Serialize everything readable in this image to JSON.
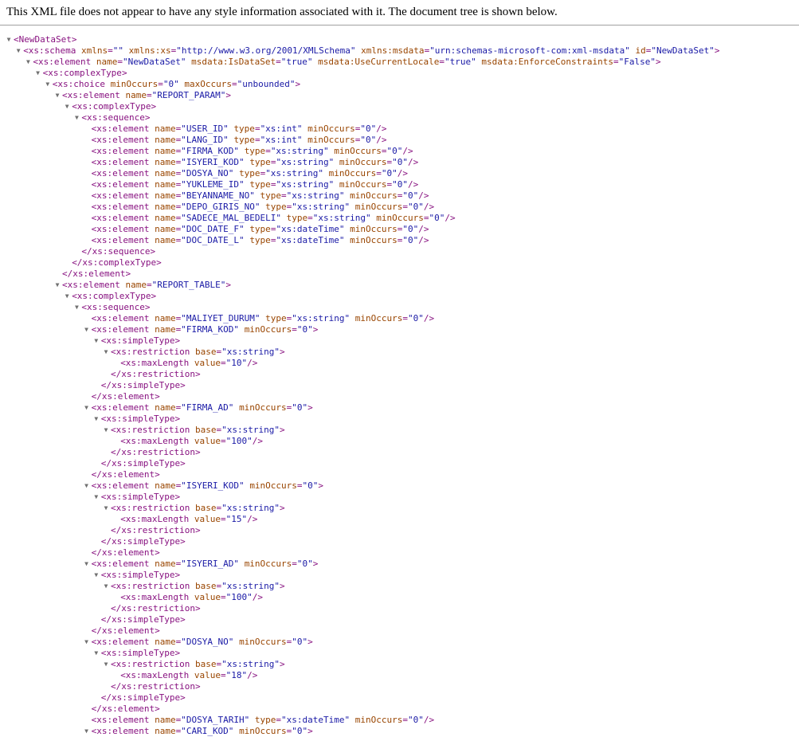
{
  "header_text": "This XML file does not appear to have any style information associated with it. The document tree is shown below.",
  "colors": {
    "tag": "#881280",
    "attribute_name": "#994500",
    "attribute_value": "#1a1aa6",
    "toggle": "#707070"
  },
  "toggle_glyph": "▼",
  "lines": [
    {
      "depth": 0,
      "toggle": true,
      "kind": "open",
      "tag": "NewDataSet",
      "attrs": []
    },
    {
      "depth": 1,
      "toggle": true,
      "kind": "open",
      "tag": "xs:schema",
      "attrs": [
        [
          "xmlns",
          ""
        ],
        [
          "xmlns:xs",
          "http://www.w3.org/2001/XMLSchema"
        ],
        [
          "xmlns:msdata",
          "urn:schemas-microsoft-com:xml-msdata"
        ],
        [
          "id",
          "NewDataSet"
        ]
      ]
    },
    {
      "depth": 2,
      "toggle": true,
      "kind": "open",
      "tag": "xs:element",
      "attrs": [
        [
          "name",
          "NewDataSet"
        ],
        [
          "msdata:IsDataSet",
          "true"
        ],
        [
          "msdata:UseCurrentLocale",
          "true"
        ],
        [
          "msdata:EnforceConstraints",
          "False"
        ]
      ]
    },
    {
      "depth": 3,
      "toggle": true,
      "kind": "open",
      "tag": "xs:complexType",
      "attrs": []
    },
    {
      "depth": 4,
      "toggle": true,
      "kind": "open",
      "tag": "xs:choice",
      "attrs": [
        [
          "minOccurs",
          "0"
        ],
        [
          "maxOccurs",
          "unbounded"
        ]
      ]
    },
    {
      "depth": 5,
      "toggle": true,
      "kind": "open",
      "tag": "xs:element",
      "attrs": [
        [
          "name",
          "REPORT_PARAM"
        ]
      ]
    },
    {
      "depth": 6,
      "toggle": true,
      "kind": "open",
      "tag": "xs:complexType",
      "attrs": []
    },
    {
      "depth": 7,
      "toggle": true,
      "kind": "open",
      "tag": "xs:sequence",
      "attrs": []
    },
    {
      "depth": 8,
      "toggle": false,
      "kind": "self",
      "tag": "xs:element",
      "attrs": [
        [
          "name",
          "USER_ID"
        ],
        [
          "type",
          "xs:int"
        ],
        [
          "minOccurs",
          "0"
        ]
      ]
    },
    {
      "depth": 8,
      "toggle": false,
      "kind": "self",
      "tag": "xs:element",
      "attrs": [
        [
          "name",
          "LANG_ID"
        ],
        [
          "type",
          "xs:int"
        ],
        [
          "minOccurs",
          "0"
        ]
      ]
    },
    {
      "depth": 8,
      "toggle": false,
      "kind": "self",
      "tag": "xs:element",
      "attrs": [
        [
          "name",
          "FIRMA_KOD"
        ],
        [
          "type",
          "xs:string"
        ],
        [
          "minOccurs",
          "0"
        ]
      ]
    },
    {
      "depth": 8,
      "toggle": false,
      "kind": "self",
      "tag": "xs:element",
      "attrs": [
        [
          "name",
          "ISYERI_KOD"
        ],
        [
          "type",
          "xs:string"
        ],
        [
          "minOccurs",
          "0"
        ]
      ]
    },
    {
      "depth": 8,
      "toggle": false,
      "kind": "self",
      "tag": "xs:element",
      "attrs": [
        [
          "name",
          "DOSYA_NO"
        ],
        [
          "type",
          "xs:string"
        ],
        [
          "minOccurs",
          "0"
        ]
      ]
    },
    {
      "depth": 8,
      "toggle": false,
      "kind": "self",
      "tag": "xs:element",
      "attrs": [
        [
          "name",
          "YUKLEME_ID"
        ],
        [
          "type",
          "xs:string"
        ],
        [
          "minOccurs",
          "0"
        ]
      ]
    },
    {
      "depth": 8,
      "toggle": false,
      "kind": "self",
      "tag": "xs:element",
      "attrs": [
        [
          "name",
          "BEYANNAME_NO"
        ],
        [
          "type",
          "xs:string"
        ],
        [
          "minOccurs",
          "0"
        ]
      ]
    },
    {
      "depth": 8,
      "toggle": false,
      "kind": "self",
      "tag": "xs:element",
      "attrs": [
        [
          "name",
          "DEPO_GIRIS_NO"
        ],
        [
          "type",
          "xs:string"
        ],
        [
          "minOccurs",
          "0"
        ]
      ]
    },
    {
      "depth": 8,
      "toggle": false,
      "kind": "self",
      "tag": "xs:element",
      "attrs": [
        [
          "name",
          "SADECE_MAL_BEDELI"
        ],
        [
          "type",
          "xs:string"
        ],
        [
          "minOccurs",
          "0"
        ]
      ]
    },
    {
      "depth": 8,
      "toggle": false,
      "kind": "self",
      "tag": "xs:element",
      "attrs": [
        [
          "name",
          "DOC_DATE_F"
        ],
        [
          "type",
          "xs:dateTime"
        ],
        [
          "minOccurs",
          "0"
        ]
      ]
    },
    {
      "depth": 8,
      "toggle": false,
      "kind": "self",
      "tag": "xs:element",
      "attrs": [
        [
          "name",
          "DOC_DATE_L"
        ],
        [
          "type",
          "xs:dateTime"
        ],
        [
          "minOccurs",
          "0"
        ]
      ]
    },
    {
      "depth": 7,
      "toggle": false,
      "kind": "close",
      "tag": "xs:sequence",
      "attrs": []
    },
    {
      "depth": 6,
      "toggle": false,
      "kind": "close",
      "tag": "xs:complexType",
      "attrs": []
    },
    {
      "depth": 5,
      "toggle": false,
      "kind": "close",
      "tag": "xs:element",
      "attrs": []
    },
    {
      "depth": 5,
      "toggle": true,
      "kind": "open",
      "tag": "xs:element",
      "attrs": [
        [
          "name",
          "REPORT_TABLE"
        ]
      ]
    },
    {
      "depth": 6,
      "toggle": true,
      "kind": "open",
      "tag": "xs:complexType",
      "attrs": []
    },
    {
      "depth": 7,
      "toggle": true,
      "kind": "open",
      "tag": "xs:sequence",
      "attrs": []
    },
    {
      "depth": 8,
      "toggle": false,
      "kind": "self",
      "tag": "xs:element",
      "attrs": [
        [
          "name",
          "MALIYET_DURUM"
        ],
        [
          "type",
          "xs:string"
        ],
        [
          "minOccurs",
          "0"
        ]
      ]
    },
    {
      "depth": 8,
      "toggle": true,
      "kind": "open",
      "tag": "xs:element",
      "attrs": [
        [
          "name",
          "FIRMA_KOD"
        ],
        [
          "minOccurs",
          "0"
        ]
      ]
    },
    {
      "depth": 9,
      "toggle": true,
      "kind": "open",
      "tag": "xs:simpleType",
      "attrs": []
    },
    {
      "depth": 10,
      "toggle": true,
      "kind": "open",
      "tag": "xs:restriction",
      "attrs": [
        [
          "base",
          "xs:string"
        ]
      ]
    },
    {
      "depth": 11,
      "toggle": false,
      "kind": "self",
      "tag": "xs:maxLength",
      "attrs": [
        [
          "value",
          "10"
        ]
      ]
    },
    {
      "depth": 10,
      "toggle": false,
      "kind": "close",
      "tag": "xs:restriction",
      "attrs": []
    },
    {
      "depth": 9,
      "toggle": false,
      "kind": "close",
      "tag": "xs:simpleType",
      "attrs": []
    },
    {
      "depth": 8,
      "toggle": false,
      "kind": "close",
      "tag": "xs:element",
      "attrs": []
    },
    {
      "depth": 8,
      "toggle": true,
      "kind": "open",
      "tag": "xs:element",
      "attrs": [
        [
          "name",
          "FIRMA_AD"
        ],
        [
          "minOccurs",
          "0"
        ]
      ]
    },
    {
      "depth": 9,
      "toggle": true,
      "kind": "open",
      "tag": "xs:simpleType",
      "attrs": []
    },
    {
      "depth": 10,
      "toggle": true,
      "kind": "open",
      "tag": "xs:restriction",
      "attrs": [
        [
          "base",
          "xs:string"
        ]
      ]
    },
    {
      "depth": 11,
      "toggle": false,
      "kind": "self",
      "tag": "xs:maxLength",
      "attrs": [
        [
          "value",
          "100"
        ]
      ]
    },
    {
      "depth": 10,
      "toggle": false,
      "kind": "close",
      "tag": "xs:restriction",
      "attrs": []
    },
    {
      "depth": 9,
      "toggle": false,
      "kind": "close",
      "tag": "xs:simpleType",
      "attrs": []
    },
    {
      "depth": 8,
      "toggle": false,
      "kind": "close",
      "tag": "xs:element",
      "attrs": []
    },
    {
      "depth": 8,
      "toggle": true,
      "kind": "open",
      "tag": "xs:element",
      "attrs": [
        [
          "name",
          "ISYERI_KOD"
        ],
        [
          "minOccurs",
          "0"
        ]
      ]
    },
    {
      "depth": 9,
      "toggle": true,
      "kind": "open",
      "tag": "xs:simpleType",
      "attrs": []
    },
    {
      "depth": 10,
      "toggle": true,
      "kind": "open",
      "tag": "xs:restriction",
      "attrs": [
        [
          "base",
          "xs:string"
        ]
      ]
    },
    {
      "depth": 11,
      "toggle": false,
      "kind": "self",
      "tag": "xs:maxLength",
      "attrs": [
        [
          "value",
          "15"
        ]
      ]
    },
    {
      "depth": 10,
      "toggle": false,
      "kind": "close",
      "tag": "xs:restriction",
      "attrs": []
    },
    {
      "depth": 9,
      "toggle": false,
      "kind": "close",
      "tag": "xs:simpleType",
      "attrs": []
    },
    {
      "depth": 8,
      "toggle": false,
      "kind": "close",
      "tag": "xs:element",
      "attrs": []
    },
    {
      "depth": 8,
      "toggle": true,
      "kind": "open",
      "tag": "xs:element",
      "attrs": [
        [
          "name",
          "ISYERI_AD"
        ],
        [
          "minOccurs",
          "0"
        ]
      ]
    },
    {
      "depth": 9,
      "toggle": true,
      "kind": "open",
      "tag": "xs:simpleType",
      "attrs": []
    },
    {
      "depth": 10,
      "toggle": true,
      "kind": "open",
      "tag": "xs:restriction",
      "attrs": [
        [
          "base",
          "xs:string"
        ]
      ]
    },
    {
      "depth": 11,
      "toggle": false,
      "kind": "self",
      "tag": "xs:maxLength",
      "attrs": [
        [
          "value",
          "100"
        ]
      ]
    },
    {
      "depth": 10,
      "toggle": false,
      "kind": "close",
      "tag": "xs:restriction",
      "attrs": []
    },
    {
      "depth": 9,
      "toggle": false,
      "kind": "close",
      "tag": "xs:simpleType",
      "attrs": []
    },
    {
      "depth": 8,
      "toggle": false,
      "kind": "close",
      "tag": "xs:element",
      "attrs": []
    },
    {
      "depth": 8,
      "toggle": true,
      "kind": "open",
      "tag": "xs:element",
      "attrs": [
        [
          "name",
          "DOSYA_NO"
        ],
        [
          "minOccurs",
          "0"
        ]
      ]
    },
    {
      "depth": 9,
      "toggle": true,
      "kind": "open",
      "tag": "xs:simpleType",
      "attrs": []
    },
    {
      "depth": 10,
      "toggle": true,
      "kind": "open",
      "tag": "xs:restriction",
      "attrs": [
        [
          "base",
          "xs:string"
        ]
      ]
    },
    {
      "depth": 11,
      "toggle": false,
      "kind": "self",
      "tag": "xs:maxLength",
      "attrs": [
        [
          "value",
          "18"
        ]
      ]
    },
    {
      "depth": 10,
      "toggle": false,
      "kind": "close",
      "tag": "xs:restriction",
      "attrs": []
    },
    {
      "depth": 9,
      "toggle": false,
      "kind": "close",
      "tag": "xs:simpleType",
      "attrs": []
    },
    {
      "depth": 8,
      "toggle": false,
      "kind": "close",
      "tag": "xs:element",
      "attrs": []
    },
    {
      "depth": 8,
      "toggle": false,
      "kind": "self",
      "tag": "xs:element",
      "attrs": [
        [
          "name",
          "DOSYA_TARIH"
        ],
        [
          "type",
          "xs:dateTime"
        ],
        [
          "minOccurs",
          "0"
        ]
      ]
    },
    {
      "depth": 8,
      "toggle": true,
      "kind": "open",
      "tag": "xs:element",
      "attrs": [
        [
          "name",
          "CARI_KOD"
        ],
        [
          "minOccurs",
          "0"
        ]
      ]
    }
  ]
}
